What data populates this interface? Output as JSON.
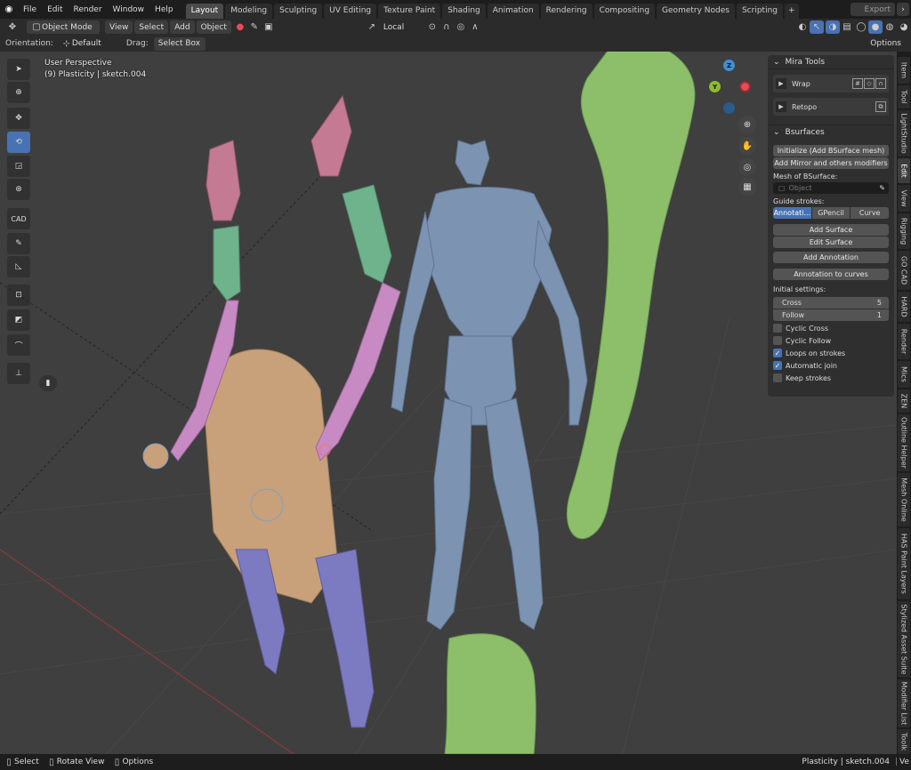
{
  "menu": [
    "File",
    "Edit",
    "Render",
    "Window",
    "Help"
  ],
  "workspaces": [
    "Layout",
    "Modeling",
    "Sculpting",
    "UV Editing",
    "Texture Paint",
    "Shading",
    "Animation",
    "Rendering",
    "Compositing",
    "Geometry Nodes",
    "Scripting"
  ],
  "active_workspace": "Layout",
  "export_label": "Export",
  "header": {
    "mode": "Object Mode",
    "view": "View",
    "select": "Select",
    "add": "Add",
    "object": "Object",
    "transform": "Local",
    "options": "Options"
  },
  "toolsettings": {
    "orientation_label": "Orientation:",
    "orientation_value": "Default",
    "drag_label": "Drag:",
    "drag_value": "Select Box"
  },
  "viewport": {
    "perspective": "User Perspective",
    "object_info": "(9) Plasticity | sketch.004"
  },
  "gizmo": {
    "z": "Z",
    "y": "Y"
  },
  "tools": [
    "cursor-tool",
    "select-tool",
    "move-tool",
    "rotate-tool",
    "scale-tool",
    "transform-tool",
    "cad-tool",
    "annotate-tool",
    "measure-tool",
    "add-cube-tool",
    "bsurface-tool",
    "curve-tool",
    "axis-tool"
  ],
  "mira": {
    "title": "Mira Tools",
    "wrap": "Wrap",
    "retopo": "Retopo"
  },
  "bsurfaces": {
    "title": "Bsurfaces",
    "initialize": "Initialize (Add BSurface mesh)",
    "add_mirror": "Add Mirror and others modifiers",
    "mesh_label": "Mesh of BSurface:",
    "object_placeholder": "Object",
    "guide_label": "Guide strokes:",
    "guide_options": [
      "Annotati...",
      "GPencil",
      "Curve"
    ],
    "add_surface": "Add Surface",
    "edit_surface": "Edit Surface",
    "add_annotation": "Add Annotation",
    "annotation_to_curves": "Annotation to curves",
    "initial_label": "Initial settings:",
    "cross_label": "Cross",
    "cross_value": "5",
    "follow_label": "Follow",
    "follow_value": "1",
    "checkboxes": [
      {
        "label": "Cyclic Cross",
        "checked": false
      },
      {
        "label": "Cyclic Follow",
        "checked": false
      },
      {
        "label": "Loops on strokes",
        "checked": true
      },
      {
        "label": "Automatic join",
        "checked": true
      },
      {
        "label": "Keep strokes",
        "checked": false
      }
    ]
  },
  "sidebar_tabs": [
    "Item",
    "Tool",
    "LightStudio",
    "Edit",
    "View",
    "Rigging",
    "GO CAD",
    "HARD",
    "Render",
    "Mics",
    "ZEN",
    "Outline Helper",
    "Mesh Online",
    "HAS Paint Layers",
    "Stylized Asset Suite",
    "Modifier List",
    "Toolk"
  ],
  "status": {
    "select": "Select",
    "rotate": "Rotate View",
    "options": "Options",
    "right": "Plasticity | sketch.004",
    "version": "Ve"
  },
  "colors": {
    "accent": "#4772b3",
    "viewport": "#3f3f3f",
    "x_axis": "#e94a55",
    "y_axis": "#8fbb2c",
    "z_axis": "#3d8fd6"
  }
}
